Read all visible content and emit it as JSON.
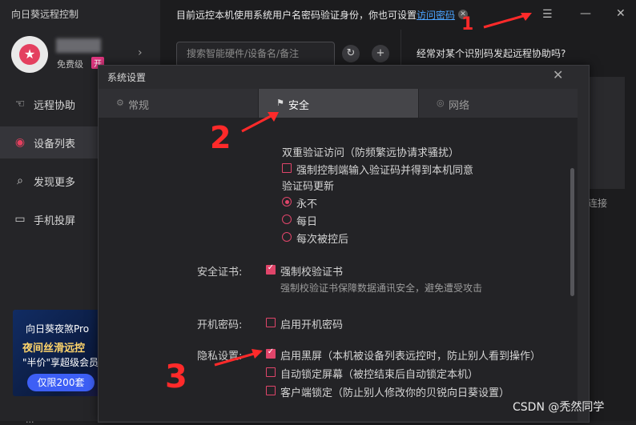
{
  "app": {
    "title": "向日葵远程控制"
  },
  "profile": {
    "tier": "免费级",
    "badge": "开"
  },
  "nav": {
    "items": [
      {
        "label": "远程协助",
        "icon": "hand-icon"
      },
      {
        "label": "设备列表",
        "icon": "device-icon"
      },
      {
        "label": "发现更多",
        "icon": "discover-icon"
      },
      {
        "label": "手机投屏",
        "icon": "screen-cast-icon"
      }
    ],
    "active": "设备列表"
  },
  "promo": {
    "line1": "向日葵夜煞Pro",
    "line2": "夜间丝滑远控",
    "line3": "\"半价\"享超级会员",
    "button": "仅限200套"
  },
  "sidebar_bottom": "...",
  "notice": {
    "text": "目前远控本机使用系统用户名密码验证身份，你也可设置",
    "link": "访问密码"
  },
  "search": {
    "placeholder": "搜索智能硬件/设备名/备注"
  },
  "right_panel": {
    "question": "经常对某个识别码发起远程协助吗?",
    "connect": "起连接"
  },
  "dialog": {
    "title": "系统设置",
    "tabs": [
      {
        "label": "常规",
        "icon": "gear-icon"
      },
      {
        "label": "安全",
        "icon": "shield-icon"
      },
      {
        "label": "网络",
        "icon": "globe-icon"
      }
    ],
    "active_tab": "安全",
    "two_factor": {
      "title": "双重验证访问（防频繁远协请求骚扰）",
      "force_code": {
        "label": "强制控制端输入验证码并得到本机同意",
        "checked": false
      }
    },
    "code_update": {
      "title": "验证码更新",
      "options": [
        "永不",
        "每日",
        "每次被控后"
      ],
      "selected": "永不"
    },
    "cert": {
      "label": "安全证书:",
      "option": "强制校验证书",
      "checked": true,
      "desc": "强制校验证书保障数据通讯安全，避免遭受攻击"
    },
    "boot_password": {
      "label": "开机密码:",
      "option": "启用开机密码",
      "checked": false
    },
    "privacy": {
      "label": "隐私设置:",
      "options": [
        {
          "label": "启用黑屏（本机被设备列表远控时，防止别人看到操作）",
          "checked": true
        },
        {
          "label": "自动锁定屏幕（被控结束后自动锁定本机）",
          "checked": false
        },
        {
          "label": "客户端锁定（防止别人修改你的贝锐向日葵设置）",
          "checked": false
        }
      ]
    }
  },
  "annotations": {
    "one": "1",
    "two": "2",
    "three": "3",
    "color": "#ff2a2a"
  },
  "watermark": "CSDN @秃然同学"
}
